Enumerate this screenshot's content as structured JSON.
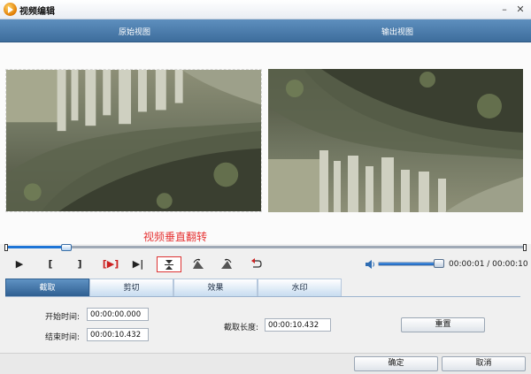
{
  "window": {
    "title": "视频编辑",
    "minimize": "–",
    "close": "✕"
  },
  "views": {
    "original_label": "原始视图",
    "output_label": "输出视图"
  },
  "caption": "视频垂直翻转",
  "timeline": {
    "progress": 0.11
  },
  "controls": {
    "play": "▶",
    "mark_in": "[",
    "mark_out": "]",
    "play_selection": "[▶]",
    "step": "▶|",
    "icons": [
      "play-icon",
      "mark-in-icon",
      "mark-out-icon",
      "play-selection-icon",
      "next-frame-icon",
      "flip-vertical-icon",
      "rotate-left-icon",
      "rotate-right-icon",
      "undo-icon"
    ],
    "volume_level": 0.85,
    "time": "00:00:01 / 00:00:10"
  },
  "tabs": [
    {
      "label": "截取",
      "active": true
    },
    {
      "label": "剪切",
      "active": false
    },
    {
      "label": "效果",
      "active": false
    },
    {
      "label": "水印",
      "active": false
    }
  ],
  "trim": {
    "start_label": "开始时间:",
    "start_value": "00:00:00.000",
    "end_label": "结束时间:",
    "end_value": "00:00:10.432",
    "length_label": "截取长度:",
    "length_value": "00:00:10.432",
    "reset_label": "重置"
  },
  "footer": {
    "ok_label": "确定",
    "cancel_label": "取消"
  },
  "colors": {
    "header": "#4a7aaa",
    "caption": "#e63333",
    "accent": "#1d74d6"
  }
}
